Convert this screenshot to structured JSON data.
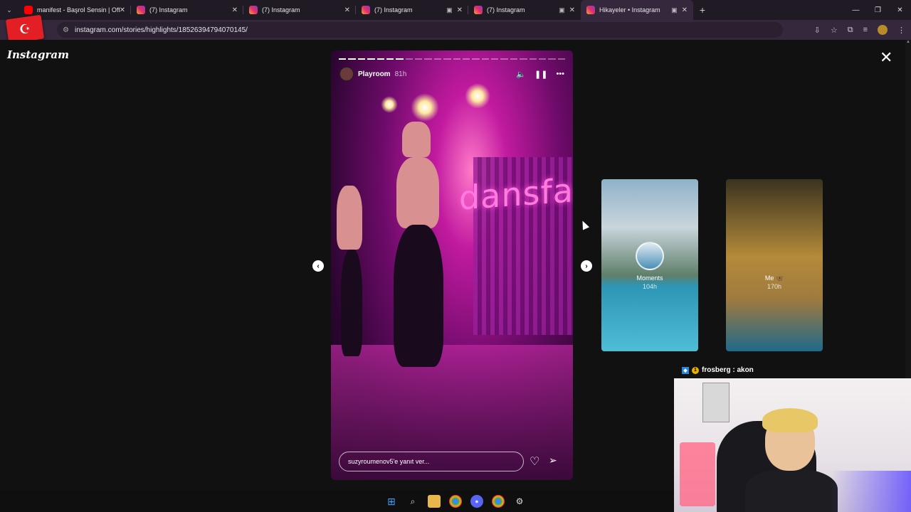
{
  "browser": {
    "tabs": [
      {
        "title": "manifest - Başrol Sensin | Offici",
        "icon": "youtube-icon",
        "active": false
      },
      {
        "title": "(7) Instagram",
        "icon": "instagram-icon",
        "active": false
      },
      {
        "title": "(7) Instagram",
        "icon": "instagram-icon",
        "active": false
      },
      {
        "title": "(7) Instagram",
        "icon": "instagram-icon",
        "active": false
      },
      {
        "title": "(7) Instagram",
        "icon": "instagram-icon",
        "active": false
      },
      {
        "title": "Hikayeler • Instagram",
        "icon": "instagram-icon",
        "active": true
      }
    ],
    "url": "instagram.com/stories/highlights/18526394794070145/"
  },
  "page": {
    "logo": "Instagram"
  },
  "story": {
    "username": "Playroom",
    "time": "81h",
    "reply_placeholder": "suzyroumenov5'e yanıt ver...",
    "overlay_text": "dansfa",
    "segments_total": 24,
    "segments_done": 7
  },
  "highlights": [
    {
      "title": "Moments",
      "time": "104h"
    },
    {
      "title": "Me 🦋",
      "time": "170h"
    }
  ],
  "overlay": {
    "chat_line": "frosberg : akon"
  },
  "colors": {
    "page_bg": "#111111",
    "chrome_bg": "#35283d",
    "accent": "#e1306c"
  }
}
